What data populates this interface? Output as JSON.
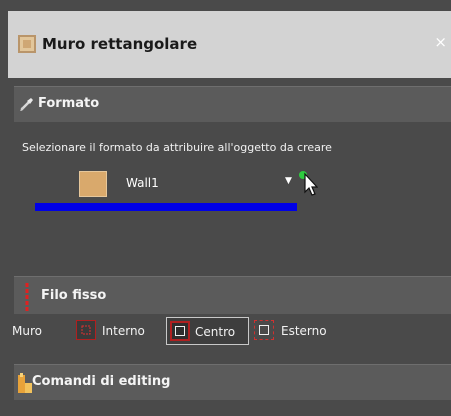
{
  "panel": {
    "title": "Muro rettangolare",
    "close_glyph": "×",
    "icon": "wall-format-icon"
  },
  "formato": {
    "header": "Formato",
    "icon": "brush-icon",
    "instruction": "Selezionare il formato da attribuire all'oggetto da creare",
    "selected_format": "Wall1",
    "swatch_color": "#d9a96c",
    "dropdown_glyph": "▼",
    "selection_bar_color": "#0000e6"
  },
  "filo_fisso": {
    "header": "Filo fisso",
    "icon": "red-line-icon",
    "row_label": "Muro",
    "options": [
      {
        "label": "Interno",
        "selected": false
      },
      {
        "label": "Centro",
        "selected": true
      },
      {
        "label": "Esterno",
        "selected": false
      }
    ]
  },
  "comandi": {
    "header": "Comandi di editing",
    "icon": "editing-icon"
  }
}
